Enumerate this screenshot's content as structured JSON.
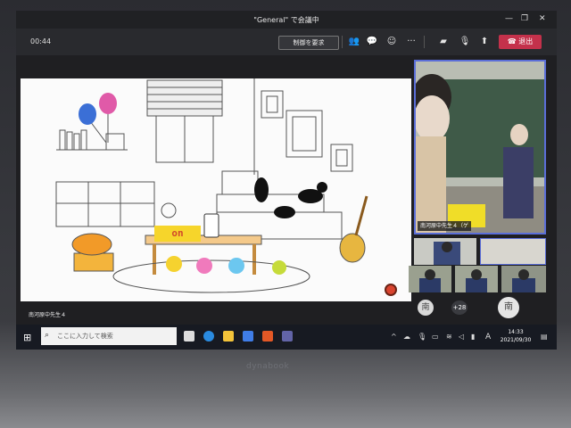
{
  "window": {
    "title": "\"General\" で会議中"
  },
  "toolbar": {
    "timer": "00:44",
    "request_control_label": "制御を要求",
    "leave_label": "退出",
    "icons": [
      "people-icon",
      "chat-icon",
      "reactions-icon",
      "more-icon",
      "camera-icon",
      "mic-icon",
      "share-icon"
    ]
  },
  "stage": {
    "presenter_name": "南河原中先生４",
    "on_label": "on"
  },
  "participants": {
    "main_video_name": "南河原中先生４（ゲ",
    "count_badge": "+28",
    "avatar_initial_1": "南",
    "avatar_initial_2": "南"
  },
  "taskbar": {
    "search_placeholder": "ここに入力して検索",
    "time": "14:33",
    "date": "2021/09/30",
    "ime": "A"
  },
  "laptop": {
    "brand": "dynabook"
  }
}
